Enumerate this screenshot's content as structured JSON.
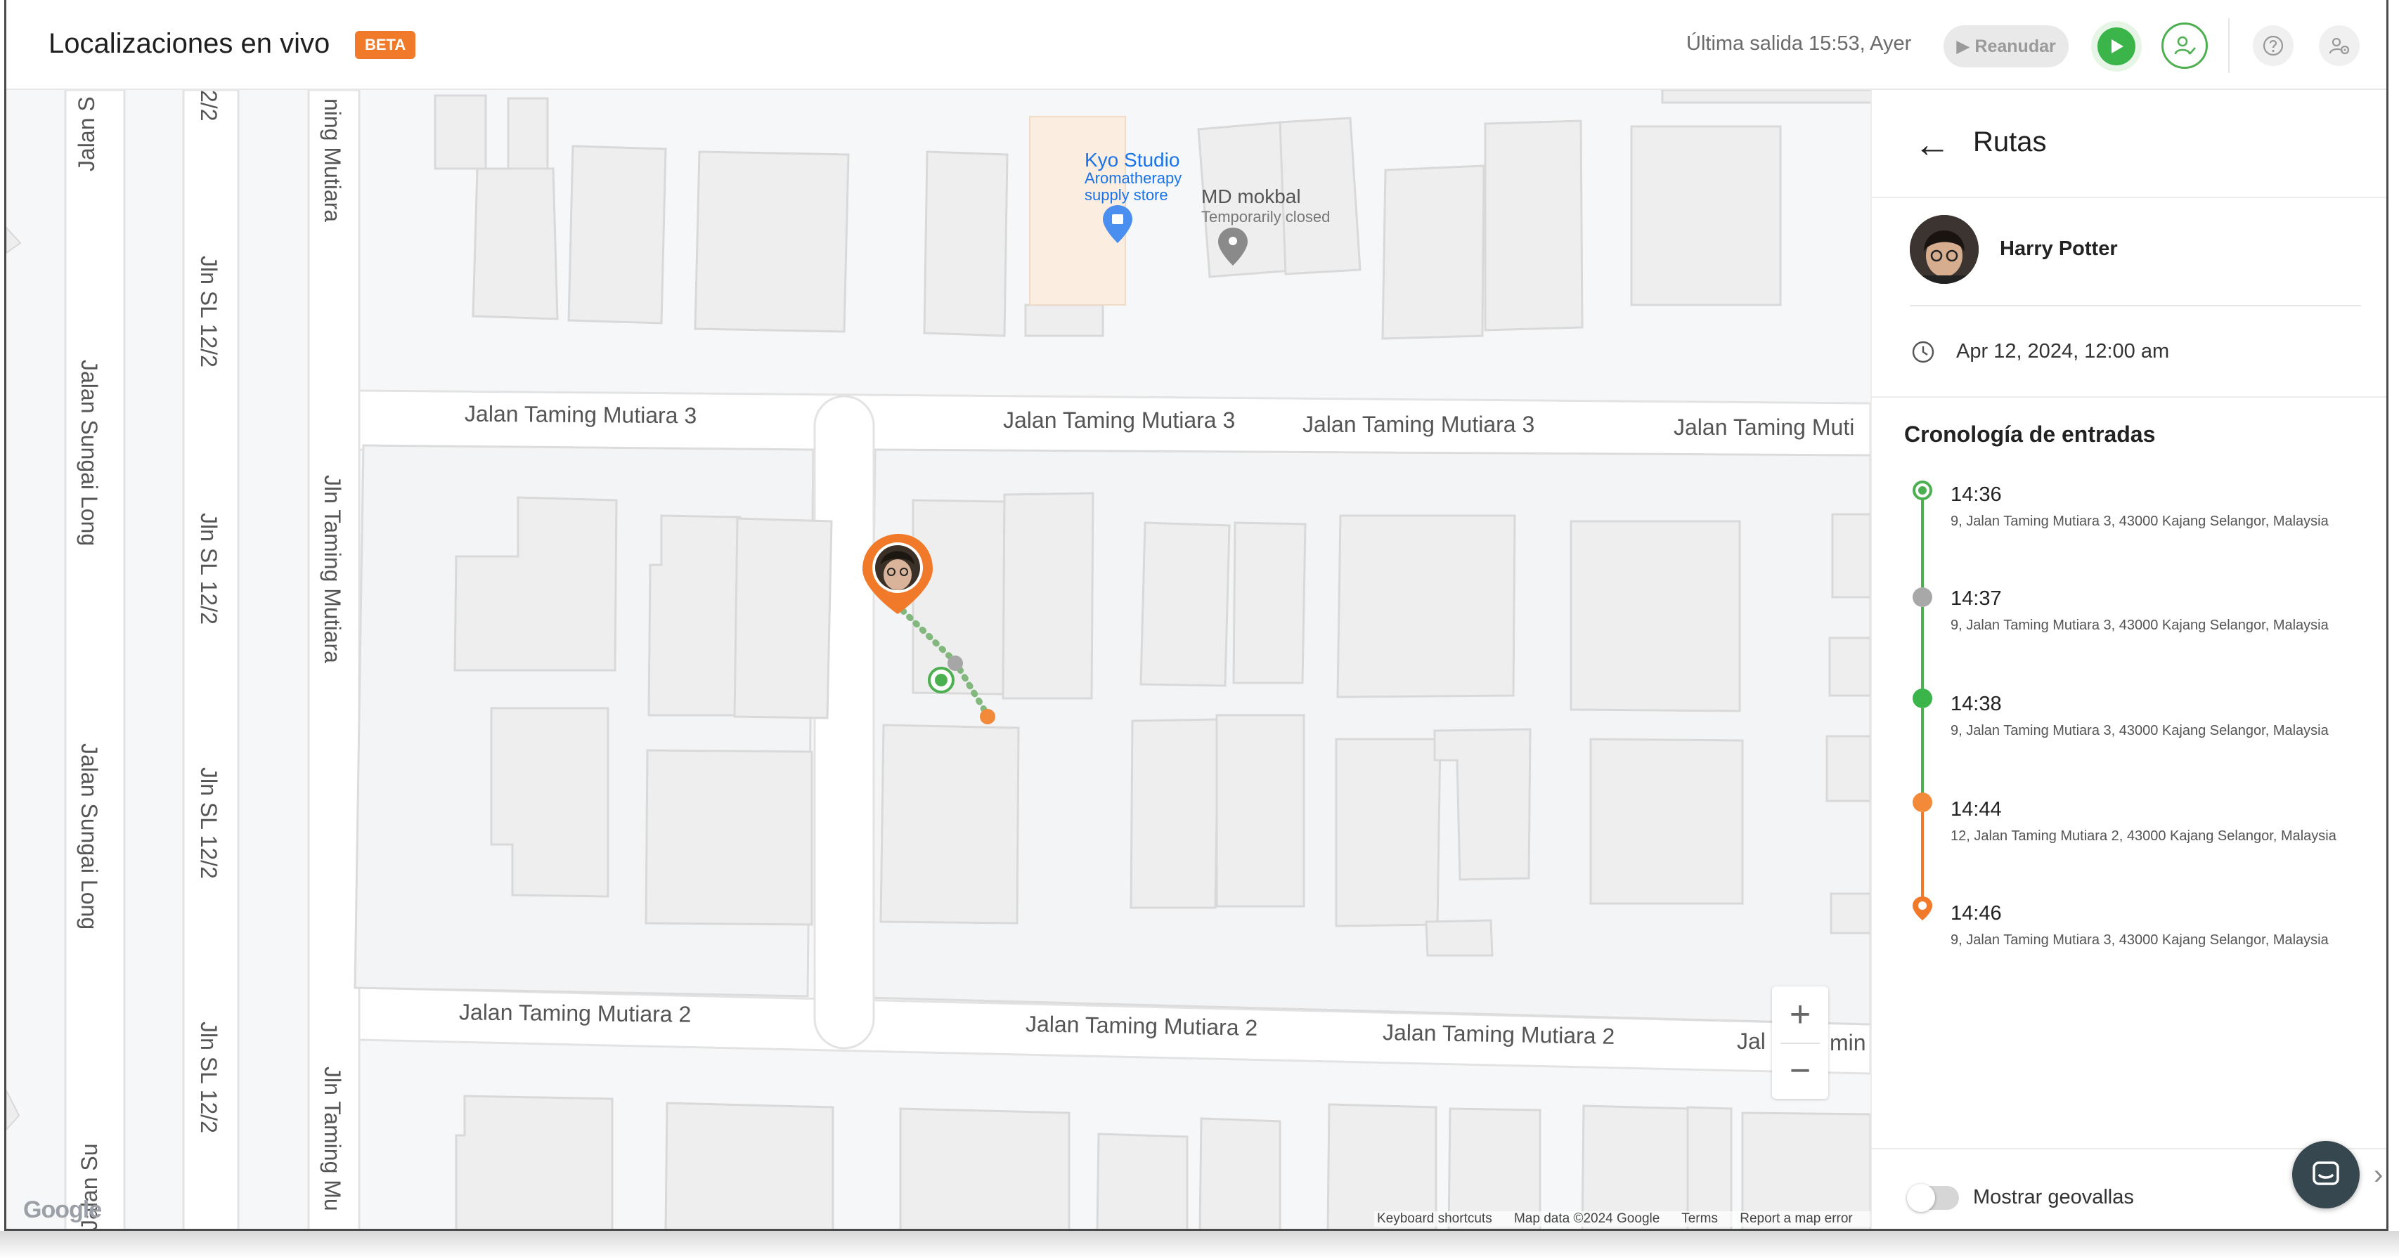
{
  "header": {
    "title": "Localizaciones en vivo",
    "badge": "BETA",
    "last_exit": "Última salida 15:53, Ayer",
    "resume_label": "▶ Reanudar"
  },
  "map": {
    "streets": {
      "taming3_a": "Jalan Taming Mutiara 3",
      "taming3_b": "Jalan Taming Mutiara 3",
      "taming3_c": "Jalan Taming Mutiara 3",
      "taming3_d": "Jalan Taming Muti",
      "taming2_a": "Jalan Taming Mutiara 2",
      "taming2_b": "Jalan Taming Mutiara 2",
      "taming2_c": "Jalan Taming Mutiara 2",
      "taming2_d": "Jal",
      "taming2_e": "min",
      "jln_taming_mutiara_top": "ning Mutiara",
      "jln_taming_mutiara_mid": "Jln Taming Mutiara",
      "jln_taming_mutiara_bot": "Jln Taming Mu",
      "jln_sl_top": "2/2",
      "jln_sl_1": "Jln SL 12/2",
      "jln_sl_2": "Jln SL 12/2",
      "jln_sl_3": "Jln SL 12/2",
      "jln_sl_4": "Jln SL 12/2",
      "sungai_top": "Jalan S",
      "sungai_1": "Jalan Sungai Long",
      "sungai_2": "Jalan Sungai Long",
      "sungai_bot": "Jalan Su"
    },
    "poi": {
      "kyo_name": "Kyo Studio",
      "kyo_sub1": "Aromatherapy",
      "kyo_sub2": "supply store",
      "md_name": "MD mokbal",
      "md_sub": "Temporarily closed"
    },
    "zoom_in": "+",
    "zoom_out": "−",
    "attribution": {
      "shortcuts": "Keyboard shortcuts",
      "data": "Map data ©2024 Google",
      "terms": "Terms",
      "report": "Report a map error"
    },
    "google_logo": "Google"
  },
  "panel": {
    "back": "←",
    "title": "Rutas",
    "person": "Harry Potter",
    "date": "Apr 12, 2024, 12:00 am",
    "timeline_title": "Cronología de entradas",
    "entries": [
      {
        "time": "14:36",
        "address": "9, Jalan Taming Mutiara 3, 43000 Kajang Selangor, Malaysia",
        "status": "start"
      },
      {
        "time": "14:37",
        "address": "9, Jalan Taming Mutiara 3, 43000 Kajang Selangor, Malaysia",
        "status": "idle"
      },
      {
        "time": "14:38",
        "address": "9, Jalan Taming Mutiara 3, 43000 Kajang Selangor, Malaysia",
        "status": "moving"
      },
      {
        "time": "14:44",
        "address": "12, Jalan Taming Mutiara 2, 43000 Kajang Selangor, Malaysia",
        "status": "stop"
      },
      {
        "time": "14:46",
        "address": "9, Jalan Taming Mutiara 3, 43000 Kajang Selangor, Malaysia",
        "status": "current"
      }
    ],
    "geofence_label": "Mostrar geovallas",
    "geofence_on": false
  },
  "colors": {
    "accent_green": "#3bb54a",
    "accent_orange": "#f07a2a",
    "idle_grey": "#a8a8a8"
  }
}
